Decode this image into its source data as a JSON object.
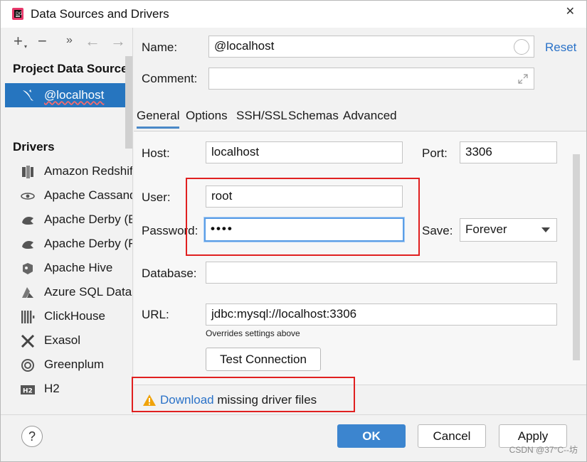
{
  "window": {
    "title": "Data Sources and Drivers",
    "close_glyph": "✕"
  },
  "toolbar": {
    "add": "+",
    "remove": "−",
    "more": "»",
    "back": "←",
    "forward": "→"
  },
  "left": {
    "project_header": "Project Data Sources",
    "data_sources": [
      {
        "label": "@localhost",
        "icon": "mysql-dolphin-icon"
      }
    ],
    "drivers_header": "Drivers",
    "drivers": [
      {
        "label": "Amazon Redshift",
        "icon": "redshift-icon"
      },
      {
        "label": "Apache Cassandra",
        "icon": "cassandra-eye-icon"
      },
      {
        "label": "Apache Derby (Embedded)",
        "icon": "derby-hat-icon"
      },
      {
        "label": "Apache Derby (Remote)",
        "icon": "derby-hat-icon"
      },
      {
        "label": "Apache Hive",
        "icon": "hive-icon"
      },
      {
        "label": "Azure SQL Database",
        "icon": "azure-icon"
      },
      {
        "label": "ClickHouse",
        "icon": "clickhouse-bars-icon"
      },
      {
        "label": "Exasol",
        "icon": "exasol-x-icon"
      },
      {
        "label": "Greenplum",
        "icon": "greenplum-icon"
      },
      {
        "label": "H2",
        "icon": "h2-icon"
      }
    ]
  },
  "form": {
    "name_label": "Name:",
    "name_value": "@localhost",
    "reset_link": "Reset",
    "comment_label": "Comment:",
    "comment_value": "",
    "tabs": [
      "General",
      "Options",
      "SSH/SSL",
      "Schemas",
      "Advanced"
    ],
    "active_tab": "General",
    "host_label": "Host:",
    "host_value": "localhost",
    "port_label": "Port:",
    "port_value": "3306",
    "user_label": "User:",
    "user_value": "root",
    "password_label": "Password:",
    "password_value": "••••",
    "save_label": "Save:",
    "save_value": "Forever",
    "database_label": "Database:",
    "database_value": "",
    "url_label": "URL:",
    "url_value": "jdbc:mysql://localhost:3306",
    "url_note": "Overrides settings above",
    "test_connection": "Test Connection"
  },
  "warning": {
    "link": "Download",
    "text": " missing driver files"
  },
  "buttons": {
    "help": "?",
    "ok": "OK",
    "cancel": "Cancel",
    "apply": "Apply"
  },
  "watermark": "CSDN @37°C--坊",
  "colors": {
    "accent": "#2675bf",
    "link": "#2a72c8",
    "annotation": "#e02020",
    "warning": "#f0a30a"
  }
}
